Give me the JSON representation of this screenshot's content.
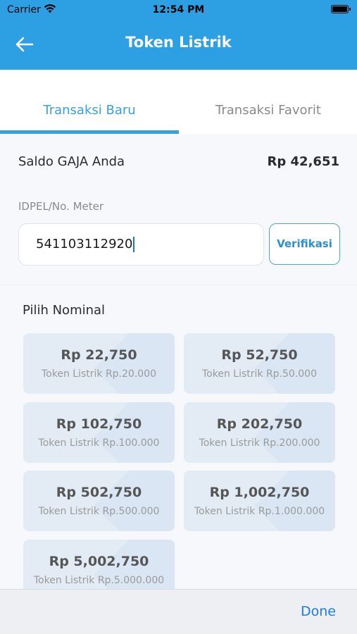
{
  "status_bar": {
    "carrier": "Carrier",
    "time": "12:54 PM"
  },
  "header": {
    "title": "Token Listrik",
    "back_icon": "arrow-left-icon"
  },
  "tabs": [
    {
      "label": "Transaksi Baru",
      "active": true
    },
    {
      "label": "Transaksi Favorit",
      "active": false
    }
  ],
  "balance": {
    "label": "Saldo GAJA Anda",
    "value": "Rp 42,651"
  },
  "idpel": {
    "label": "IDPEL/No. Meter",
    "value": "541103112920",
    "verify_label": "Verifikasi"
  },
  "nominal": {
    "label": "Pilih Nominal",
    "options": [
      {
        "price": "Rp 22,750",
        "desc": "Token Listrik Rp.20.000"
      },
      {
        "price": "Rp 52,750",
        "desc": "Token Listrik Rp.50.000"
      },
      {
        "price": "Rp 102,750",
        "desc": "Token Listrik Rp.100.000"
      },
      {
        "price": "Rp 202,750",
        "desc": "Token Listrik Rp.200.000"
      },
      {
        "price": "Rp 502,750",
        "desc": "Token Listrik Rp.500.000"
      },
      {
        "price": "Rp 1,002,750",
        "desc": "Token Listrik Rp.1.000.000"
      },
      {
        "price": "Rp 5,002,750",
        "desc": "Token Listrik Rp.5.000.000"
      }
    ]
  },
  "keyboard_accessory": {
    "done_label": "Done"
  },
  "colors": {
    "primary": "#2d9fe3",
    "accent": "#3aa0db",
    "card_bg": "#e3ecf5"
  }
}
